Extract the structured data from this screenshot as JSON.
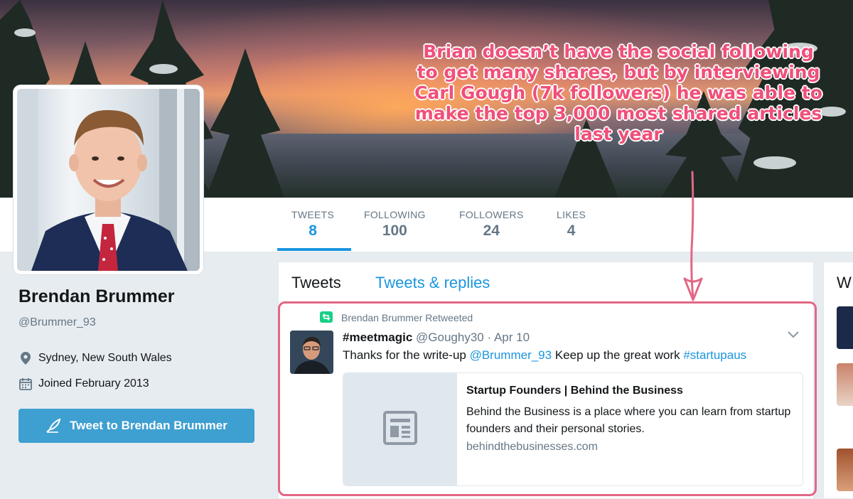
{
  "colors": {
    "accent": "#1b95e0",
    "annotation": "#f04f7a",
    "tweet_button": "#3e9fd1",
    "retweet": "#19cf86"
  },
  "nav": {
    "stats": [
      {
        "label": "TWEETS",
        "value": "8"
      },
      {
        "label": "FOLLOWING",
        "value": "100"
      },
      {
        "label": "FOLLOWERS",
        "value": "24"
      },
      {
        "label": "LIKES",
        "value": "4"
      }
    ]
  },
  "profile": {
    "name": "Brendan Brummer",
    "handle": "@Brummer_93",
    "location": "Sydney, New South Wales",
    "joined": "Joined February 2013",
    "tweet_button": "Tweet to Brendan Brummer",
    "icons": {
      "location": "location-pin-icon",
      "calendar": "calendar-icon",
      "tweet": "quill-icon"
    }
  },
  "timeline": {
    "tabs": [
      "Tweets",
      "Tweets & replies"
    ],
    "tweet": {
      "retweeted_by": "Brendan Brummer Retweeted",
      "display_name": "#meetmagic",
      "screen_name": "@Goughy30",
      "separator": "·",
      "date": "Apr 10",
      "text_before": "Thanks for the write-up ",
      "mention": "@Brummer_93",
      "text_middle": " Keep up the great work ",
      "hashtag": "#startupaus",
      "card": {
        "title": "Startup Founders | Behind the Business",
        "description": "Behind the Business is a place where you can learn from startup founders and their personal stories.",
        "url": "behindthebusinesses.com"
      }
    }
  },
  "right_column": {
    "heading_fragment": "W"
  },
  "annotation": {
    "lines": [
      "Brian doesn’t have the social following",
      "to get many shares, but by interviewing",
      "Carl Gough (7k followers) he was able to",
      "make the top 3,000 most shared articles",
      "last year"
    ]
  }
}
